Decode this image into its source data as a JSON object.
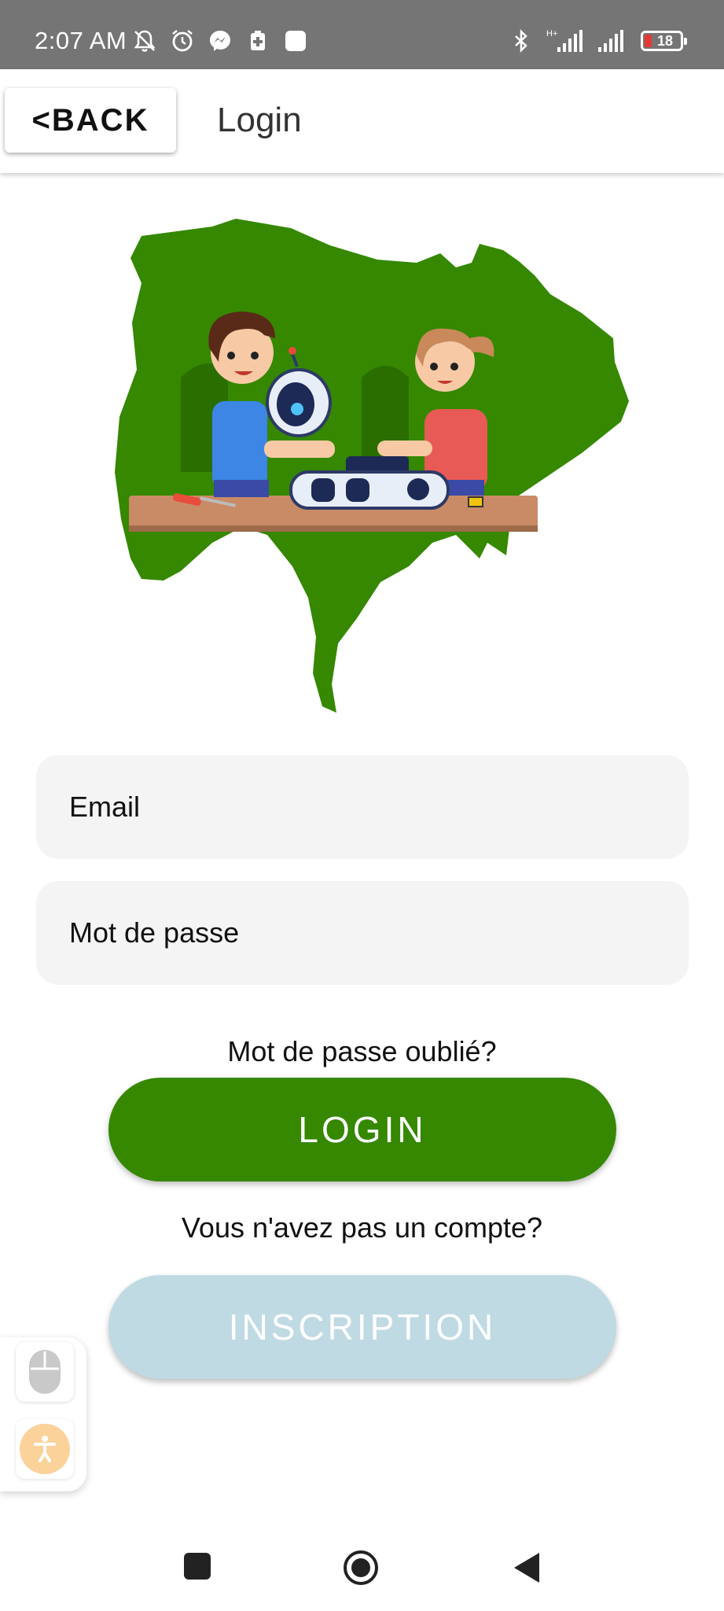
{
  "status_bar": {
    "time": "2:07 AM",
    "battery_level": "18",
    "network": "H+",
    "icons": [
      "mute-icon",
      "alarm-icon",
      "messenger-icon",
      "battery-saver-icon",
      "app-icon",
      "bluetooth-icon",
      "signal-icon",
      "signal-icon",
      "battery-icon"
    ]
  },
  "header": {
    "back_label": "<BACK",
    "title": "Login"
  },
  "form": {
    "email_placeholder": "Email",
    "password_placeholder": "Mot de passe",
    "forgot_password": "Mot de passe oublié?",
    "login_label": "LOGIN",
    "no_account": "Vous n'avez pas un compte?",
    "inscription_label": "INSCRIPTION"
  },
  "colors": {
    "primary_green": "#358800",
    "inscription_bg": "#bfdae3",
    "map_green": "#358800",
    "status_bar": "#757575"
  },
  "side_panel": {
    "icons": [
      "mouse-icon",
      "accessibility-icon"
    ]
  },
  "nav_bar": {
    "icons": [
      "recents-icon",
      "home-icon",
      "back-icon"
    ]
  }
}
